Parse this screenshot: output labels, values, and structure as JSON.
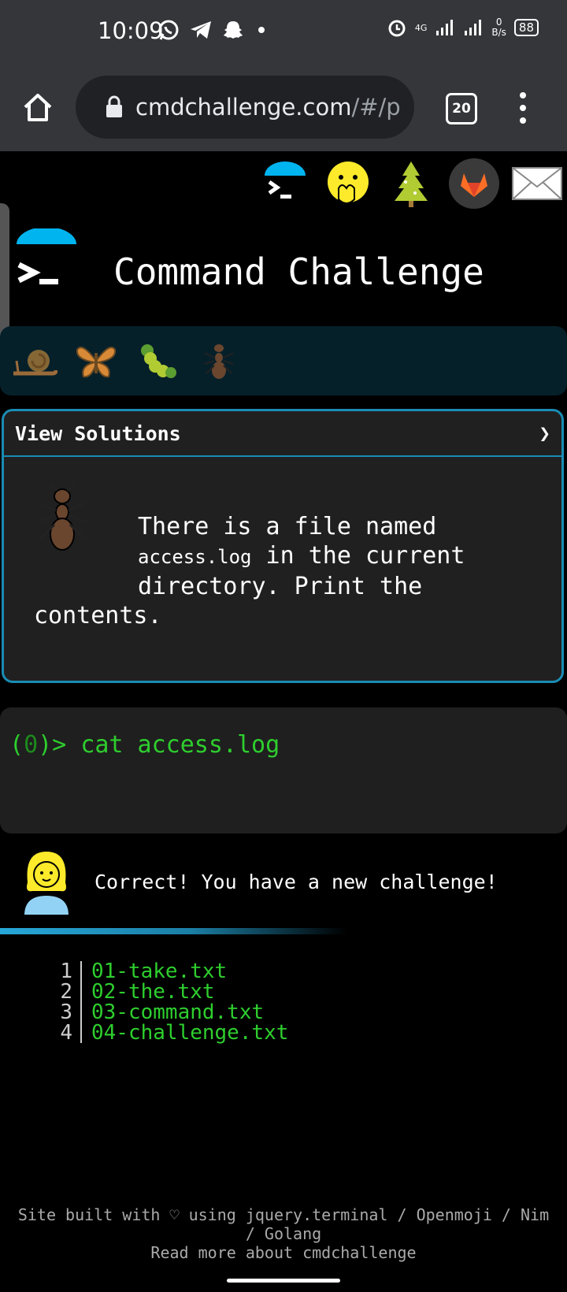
{
  "status_bar": {
    "time": "10:09",
    "network": "4G",
    "speed": "0",
    "speed_unit": "B/s",
    "battery": "88"
  },
  "browser": {
    "url_main": "cmdchallenge.com",
    "url_rest": "/#/p",
    "tab_count": "20"
  },
  "site": {
    "title": "Command Challenge",
    "nav_icons": [
      "terminal-icon",
      "face-with-hand-over-mouth-icon",
      "tree-icon",
      "gitlab-icon",
      "envelope-icon"
    ],
    "bugs": [
      "snail-icon",
      "butterfly-icon",
      "caterpillar-icon",
      "ant-icon"
    ]
  },
  "challenge": {
    "header": "View Solutions",
    "chevron": "❯",
    "text_1": "There is a file named",
    "code": "access.log",
    "text_2": " in the current",
    "text_3": "directory. Print the",
    "text_4": "contents."
  },
  "terminal": {
    "prompt_open": "(",
    "prompt_num": "0",
    "prompt_close": ")> ",
    "command": "cat access.log"
  },
  "result": {
    "message": "Correct! You have a new challenge!"
  },
  "listing": [
    {
      "n": "1",
      "file": "01-take.txt"
    },
    {
      "n": "2",
      "file": "02-the.txt"
    },
    {
      "n": "3",
      "file": "03-command.txt"
    },
    {
      "n": "4",
      "file": "04-challenge.txt"
    }
  ],
  "footer": {
    "line1": "Site built with ♡ using jquery.terminal / Openmoji / Nim",
    "line2": "/ Golang",
    "line3": "Read more about cmdchallenge"
  }
}
